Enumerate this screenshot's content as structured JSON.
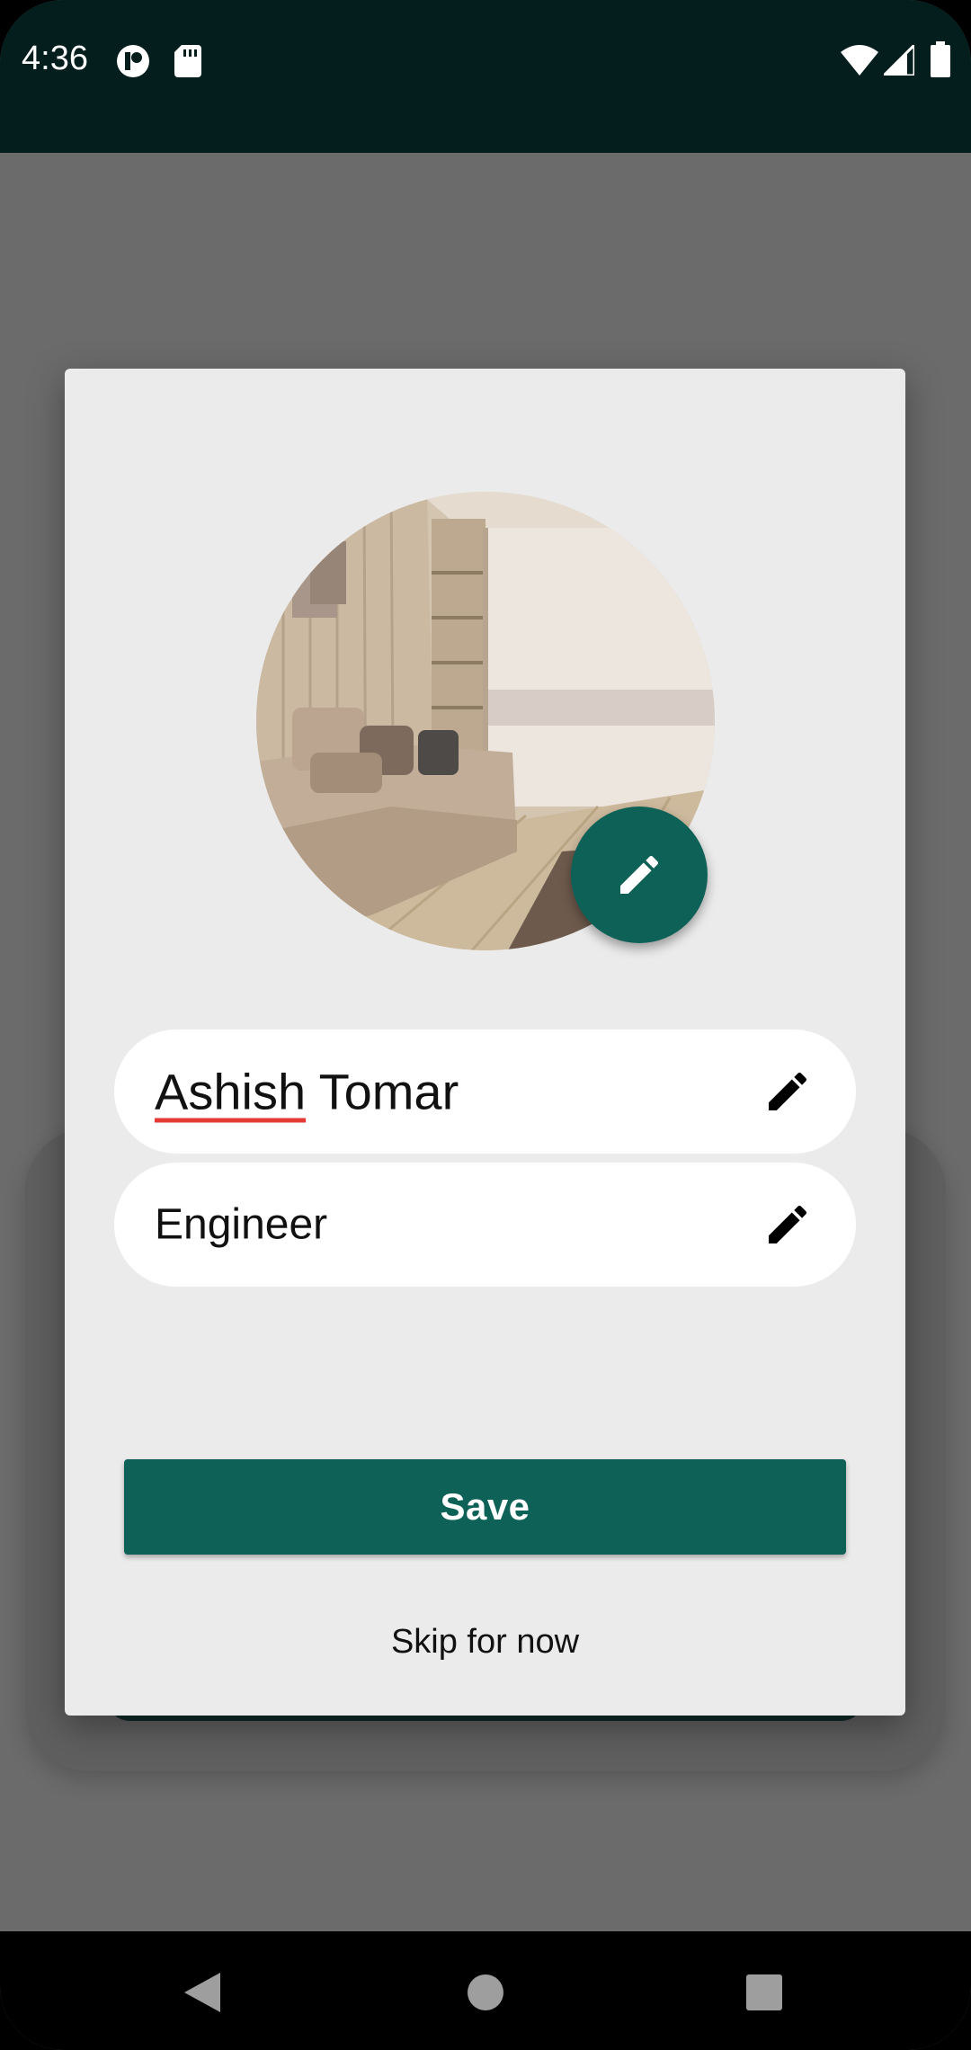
{
  "status_bar": {
    "time": "4:36",
    "icons": [
      "app-notification-icon",
      "sd-card-icon",
      "wifi-icon",
      "signal-icon",
      "battery-icon"
    ]
  },
  "dialog": {
    "avatar": {
      "icon": "room-photo",
      "edit_icon": "pencil-icon"
    },
    "name_field": {
      "first": "Ashish",
      "rest": " Tomar",
      "edit_icon": "pencil-icon"
    },
    "title_field": {
      "value": "Engineer",
      "edit_icon": "pencil-icon"
    },
    "save_label": "Save",
    "skip_label": "Skip for now"
  },
  "nav_bar": {
    "buttons": [
      "back-icon",
      "home-icon",
      "recents-icon"
    ]
  },
  "colors": {
    "accent": "#0e6157",
    "status_bar": "#031e1c",
    "scrim": "#6b6b6b",
    "dialog_bg": "#ebebeb"
  }
}
